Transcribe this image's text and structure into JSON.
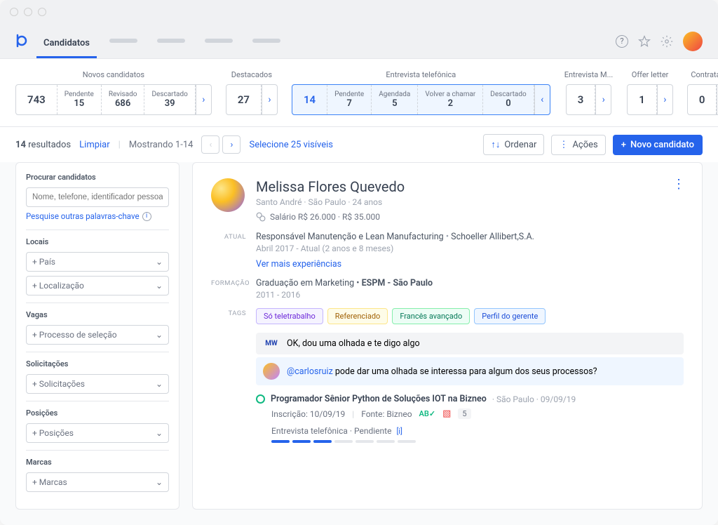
{
  "nav": {
    "tab_candidates": "Candidatos"
  },
  "pipeline": {
    "stage1": {
      "title": "Novos candidatos",
      "total": "743",
      "cells": [
        {
          "label": "Pendente",
          "value": "15"
        },
        {
          "label": "Revisado",
          "value": "686"
        },
        {
          "label": "Descartado",
          "value": "39"
        }
      ]
    },
    "stage2": {
      "title": "Destacados",
      "value": "27"
    },
    "stage3": {
      "title": "Entrevista telefônica",
      "total": "14",
      "cells": [
        {
          "label": "Pendente",
          "value": "7"
        },
        {
          "label": "Agendada",
          "value": "5"
        },
        {
          "label": "Volver a chamar",
          "value": "2"
        },
        {
          "label": "Descartado",
          "value": "0"
        }
      ]
    },
    "stage4": {
      "title": "Entrevista M...",
      "value": "3"
    },
    "stage5": {
      "title": "Offer letter",
      "value": "1"
    },
    "stage6": {
      "title": "Contratado",
      "value": "0"
    }
  },
  "controlbar": {
    "count_prefix": "14",
    "count_suffix": " resultados",
    "clear": "Limpiar",
    "showing": "Mostrando 1-14",
    "select_visible": "Selecione 25 visíveis",
    "sort": "Ordenar",
    "actions": "Ações",
    "new_candidate": "Novo candidato"
  },
  "sidebar": {
    "search_title": "Procurar candidatos",
    "search_placeholder": "Nome, telefone, identificador pessoal, ID...",
    "search_help": "Pesquise outras palavras-chave",
    "locations_title": "Locais",
    "country": "+ País",
    "location": "+ Localização",
    "jobs_title": "Vagas",
    "jobs_select": "+ Processo de seleção",
    "reqs_title": "Solicitações",
    "reqs_select": "+ Solicitações",
    "positions_title": "Posições",
    "positions_select": "+ Posições",
    "brands_title": "Marcas",
    "brands_select": "+ Marcas"
  },
  "candidate": {
    "name": "Melissa Flores Quevedo",
    "location": "Santo André · São Paulo · 24 anos",
    "salary": "Salário R$ 26.000 · R$ 35.000",
    "current_label": "ATUAL",
    "current_title": "Responsável Manutenção e Lean Manufacturing",
    "current_company": "Schoeller Allibert,S.A.",
    "current_dates": "Abril 2017 - Atual (2 anos e 8 meses)",
    "more_exp": "Ver mais experiências",
    "education_label": "FORMAÇÃO",
    "education_degree": "Graduação em Marketing",
    "education_school": "ESPM - São Paulo",
    "education_dates": "2011 - 2016",
    "tags_label": "TAGS",
    "tags": {
      "t1": "Só teletrabalho",
      "t2": "Referenciado",
      "t3": "Francês avançado",
      "t4": "Perfil do gerente"
    },
    "comment1_author": "MW",
    "comment1": "OK, dou uma olhada e te digo algo",
    "comment2_mention": "@carlosruiz",
    "comment2_text": " pode dar uma olhada se interessa para algum dos seus processos?",
    "job": {
      "title": "Programador Sênior Python de Soluções IOT na Bizneo",
      "meta": "· São Paulo · 09/09/19",
      "inscription": "Inscrição: 10/09/19",
      "source": "Fonte: Bizneo",
      "ab": "AB✓",
      "count": "5",
      "stage": "Entrevista telefônica · Pendiente"
    }
  }
}
